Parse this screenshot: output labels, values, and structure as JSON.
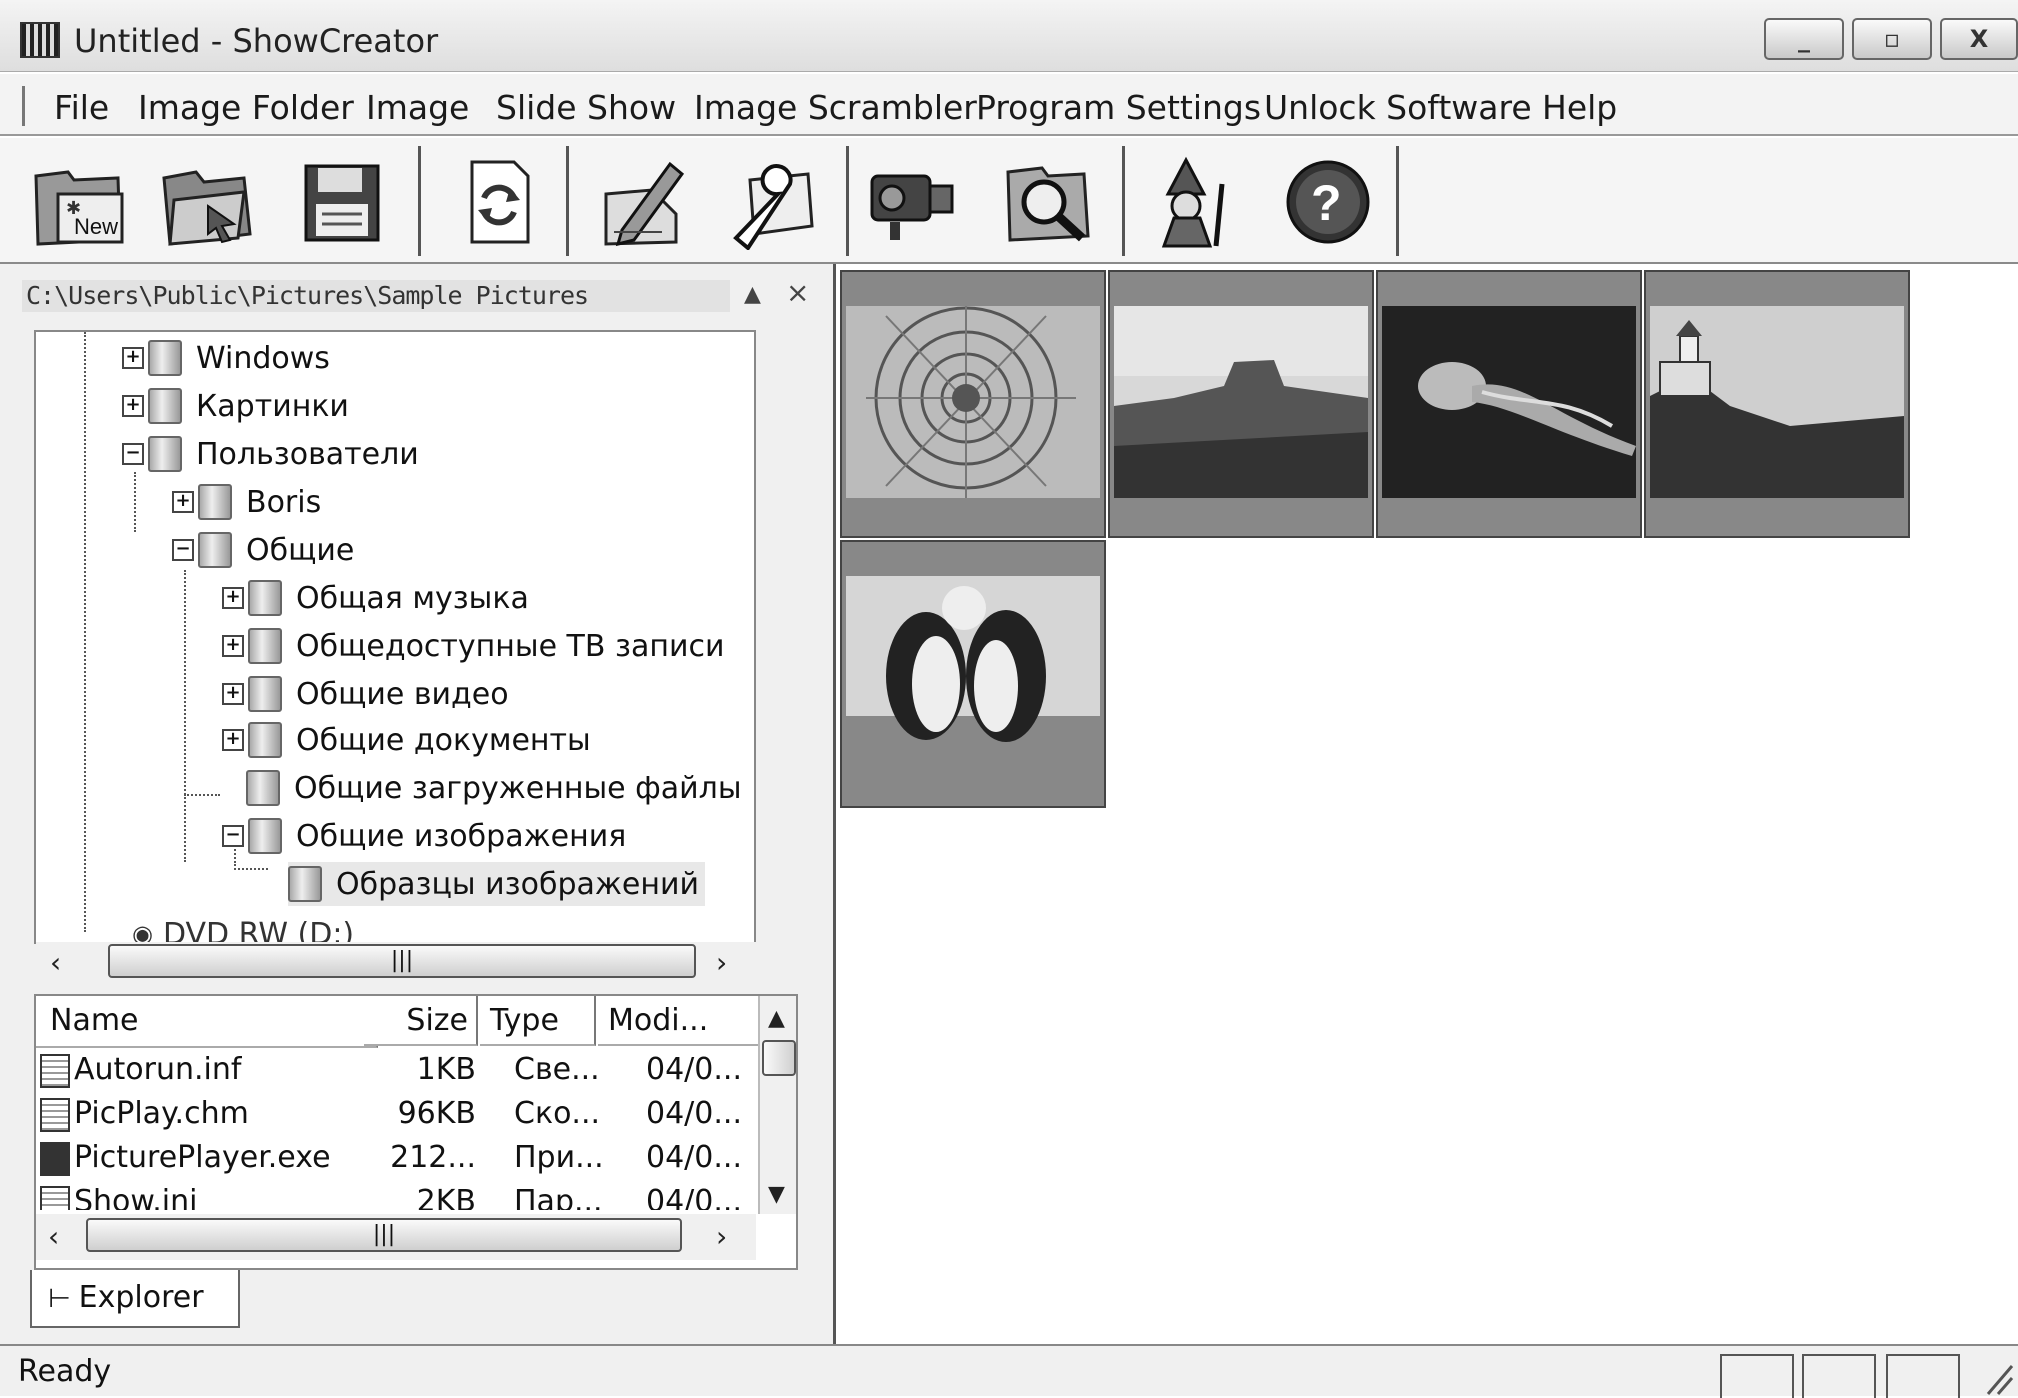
{
  "window": {
    "title": "Untitled - ShowCreator",
    "minimize": "_",
    "maximize": "▫",
    "close": "X"
  },
  "menu": [
    "File",
    "Image Folder",
    "Image",
    "Slide Show",
    "Image Scrambler",
    "Program Settings",
    "Unlock Software",
    "Help"
  ],
  "toolbar": {
    "new_label": "New",
    "buttons": [
      "new-show",
      "open-show",
      "save-show",
      "refresh",
      "edit-image",
      "settings",
      "slide-show-projector",
      "magnifier",
      "scrambler-wizard",
      "help"
    ]
  },
  "explorer": {
    "path": "C:\\Users\\Public\\Pictures\\Sample Pictures",
    "pin": "▲",
    "close": "×",
    "tree": [
      {
        "label": "Windows",
        "expander": "+"
      },
      {
        "label": "Картинки",
        "expander": "+"
      },
      {
        "label": "Пользователи",
        "expander": "−"
      },
      {
        "label": "Boris",
        "expander": "+"
      },
      {
        "label": "Общие",
        "expander": "−"
      },
      {
        "label": "Общая музыка",
        "expander": "+"
      },
      {
        "label": "Общедоступные ТВ записи",
        "expander": "+"
      },
      {
        "label": "Общие видео",
        "expander": "+"
      },
      {
        "label": "Общие документы",
        "expander": "+"
      },
      {
        "label": "Общие загруженные файлы",
        "expander": ""
      },
      {
        "label": "Общие изображения",
        "expander": "−"
      },
      {
        "label": "Образцы изображений",
        "expander": ""
      }
    ],
    "tree_cut_label": "DVD RW                 (D:)",
    "tab_label": "Explorer"
  },
  "files": {
    "columns": [
      "Name",
      "Size",
      "Type",
      "Modi..."
    ],
    "rows": [
      {
        "name": "Autorun.inf",
        "size": "1KB",
        "type": "Све...",
        "modified": "04/0..."
      },
      {
        "name": "PicPlay.chm",
        "size": "96KB",
        "type": "Ско...",
        "modified": "04/0..."
      },
      {
        "name": "PicturePlayer.exe",
        "size": "212...",
        "type": "При...",
        "modified": "04/0..."
      },
      {
        "name": "Show.ini",
        "size": "2KB",
        "type": "Пар...",
        "modified": "04/0..."
      }
    ]
  },
  "scroll_glyphs": {
    "up": "▲",
    "down": "▼",
    "left": "‹",
    "right": "›",
    "thumb": "|||"
  },
  "thumbnails": [
    "chrysanthemum",
    "desert",
    "jellyfish",
    "lighthouse",
    "penguins"
  ],
  "status": {
    "text": "Ready"
  }
}
